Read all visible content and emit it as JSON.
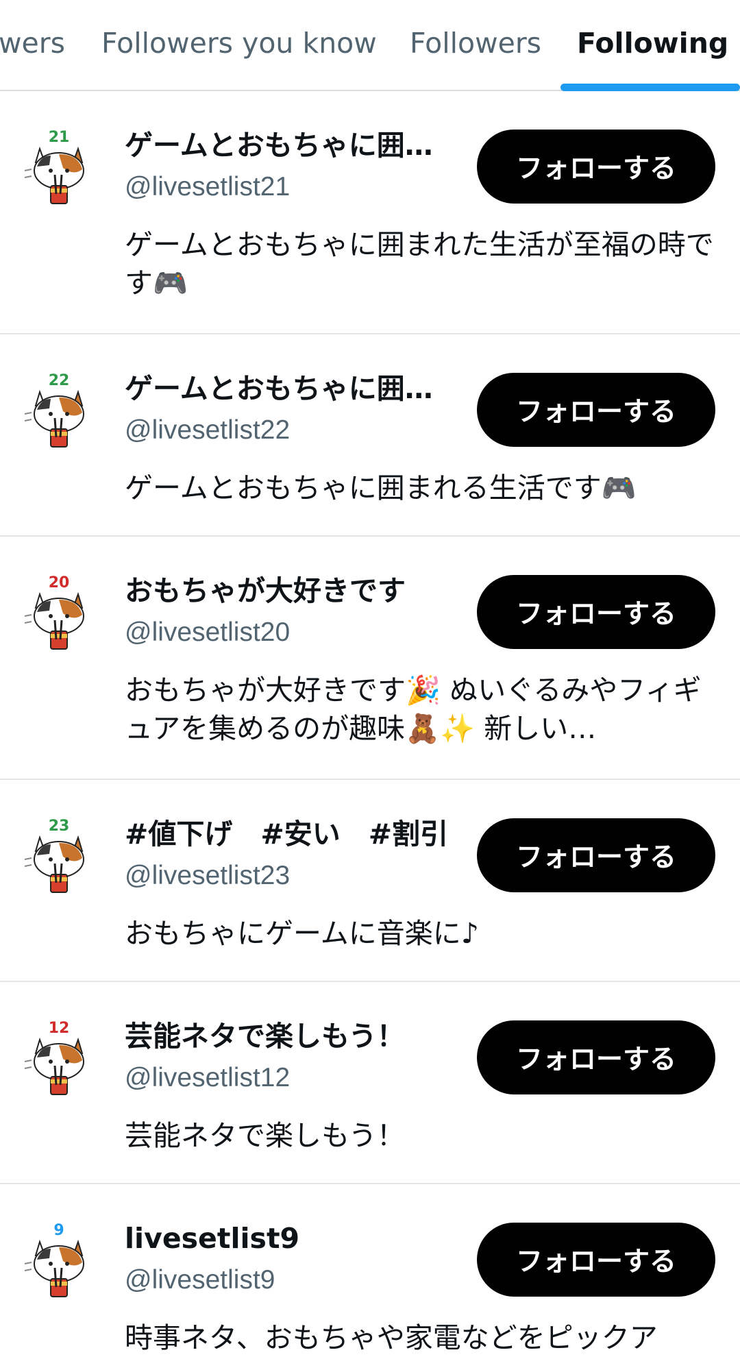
{
  "tabs": [
    {
      "label": "wers",
      "active": false
    },
    {
      "label": "Followers you know",
      "active": false
    },
    {
      "label": "Followers",
      "active": false
    },
    {
      "label": "Following",
      "active": true
    }
  ],
  "colors": {
    "accent": "#1d9bf0",
    "button_bg": "#000000",
    "secondary_text": "#536471"
  },
  "users": [
    {
      "badge": "21",
      "badge_color": "#2e9b4a",
      "name": "ゲームとおもちゃに囲まれた生活が至福の時です",
      "handle": "@livesetlist21",
      "button": "フォローする",
      "bio": "ゲームとおもちゃに囲まれた生活が至福の時です🎮"
    },
    {
      "badge": "22",
      "badge_color": "#2e9b4a",
      "name": "ゲームとおもちゃに囲まれる生活です",
      "handle": "@livesetlist22",
      "button": "フォローする",
      "bio": "ゲームとおもちゃに囲まれる生活です🎮"
    },
    {
      "badge": "20",
      "badge_color": "#d22b2b",
      "name": "おもちゃが大好きです",
      "handle": "@livesetlist20",
      "button": "フォローする",
      "bio": "おもちゃが大好きです🎉 ぬいぐるみやフィギュアを集めるのが趣味🧸✨ 新しい…"
    },
    {
      "badge": "23",
      "badge_color": "#2e9b4a",
      "name": "#値下げ　#安い　#割引",
      "handle": "@livesetlist23",
      "button": "フォローする",
      "bio": "おもちゃにゲームに音楽に♪"
    },
    {
      "badge": "12",
      "badge_color": "#d22b2b",
      "name": "芸能ネタで楽しもう！",
      "handle": "@livesetlist12",
      "button": "フォローする",
      "bio": "芸能ネタで楽しもう！"
    },
    {
      "badge": "9",
      "badge_color": "#1d9bf0",
      "name": "livesetlist9",
      "handle": "@livesetlist9",
      "button": "フォローする",
      "bio": "時事ネタ、おもちゃや家電などをピックア"
    }
  ]
}
